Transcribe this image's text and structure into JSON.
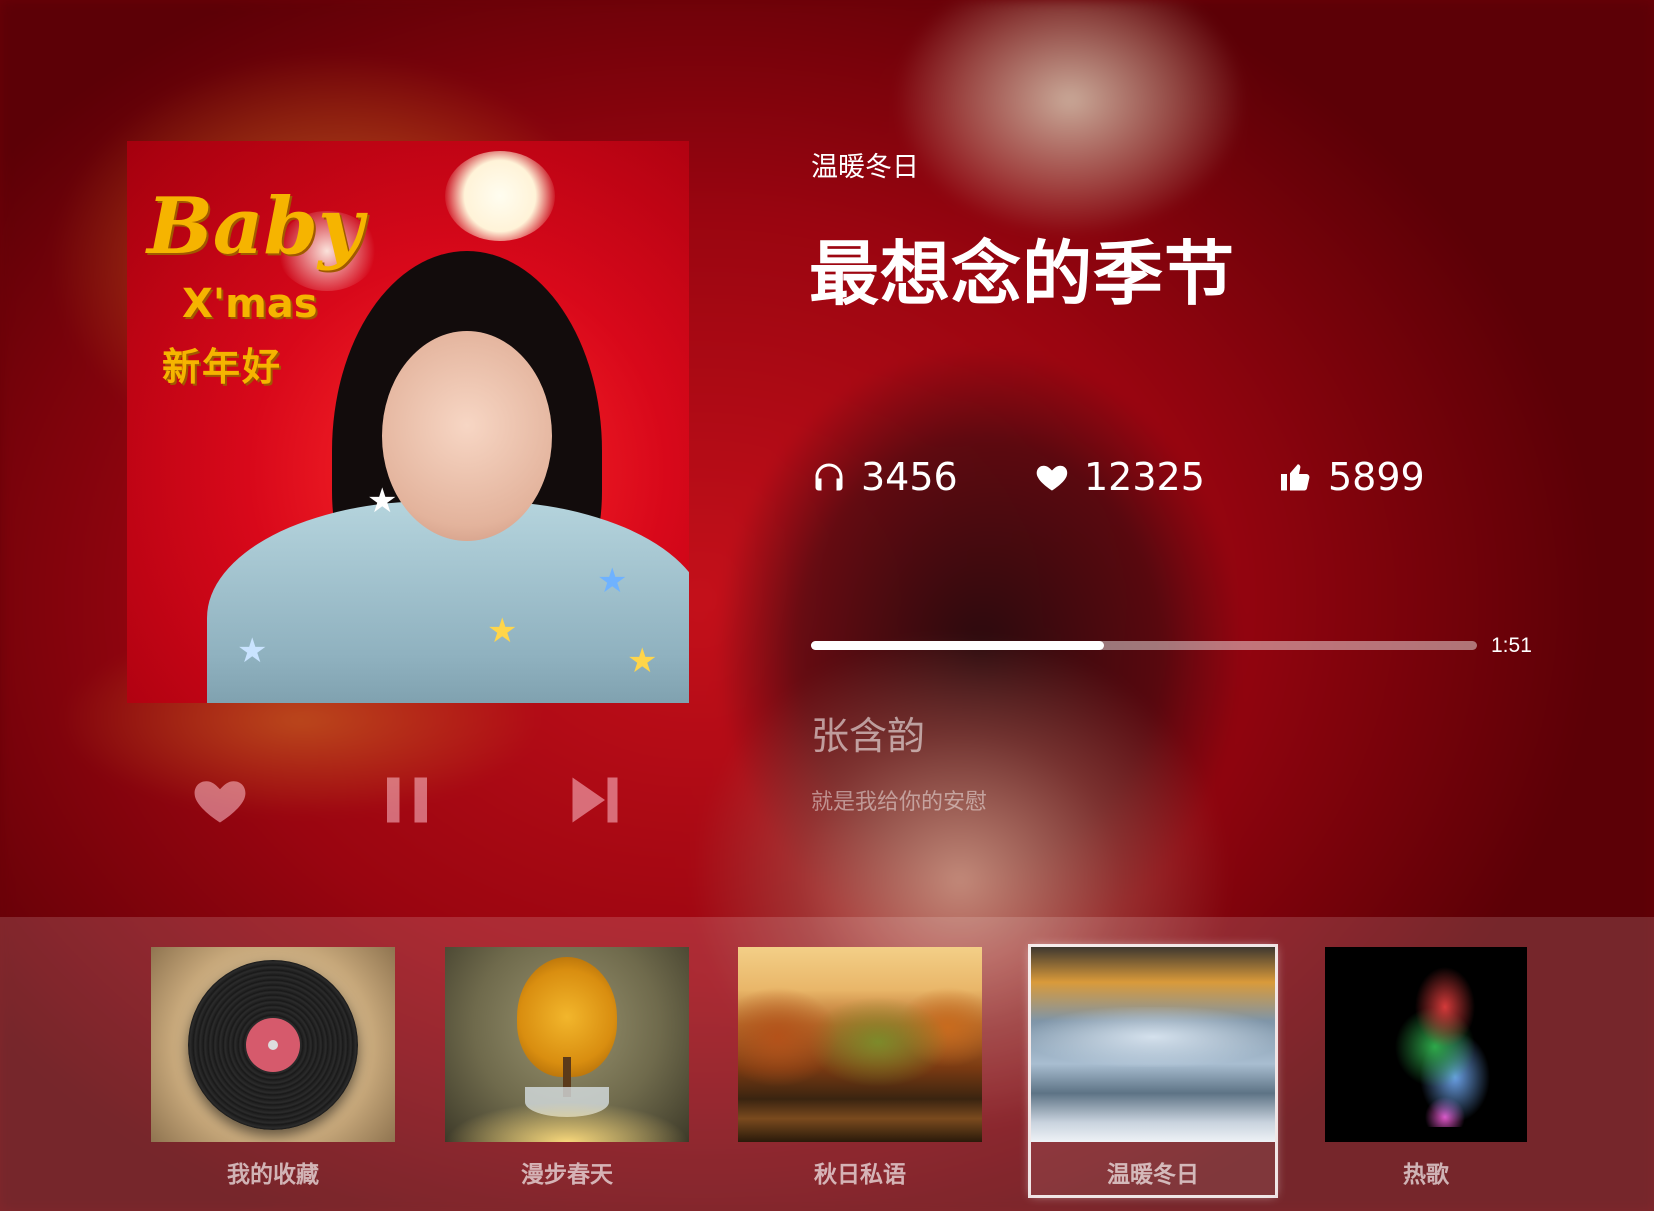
{
  "now_playing": {
    "category": "温暖冬日",
    "title": "最想念的季节",
    "artist": "张含韵",
    "lyric": "就是我给你的安慰",
    "elapsed_time": "1:51",
    "progress": 0.44
  },
  "stats": {
    "listens": "3456",
    "favorites": "12325",
    "likes": "5899"
  },
  "album_cover": {
    "title_text": "Baby",
    "subtitle_text": "X'mas",
    "tagline_text": "新年好"
  },
  "controls": {
    "favorite_icon": "heart-icon",
    "pause_icon": "pause-icon",
    "next_icon": "skip-next-icon"
  },
  "playlists": [
    {
      "label": "我的收藏",
      "selected": false
    },
    {
      "label": "漫步春天",
      "selected": false
    },
    {
      "label": "秋日私语",
      "selected": false
    },
    {
      "label": "温暖冬日",
      "selected": true
    },
    {
      "label": "热歌",
      "selected": false
    }
  ],
  "colors": {
    "background": "#9a0510",
    "accent": "#ffffff"
  }
}
